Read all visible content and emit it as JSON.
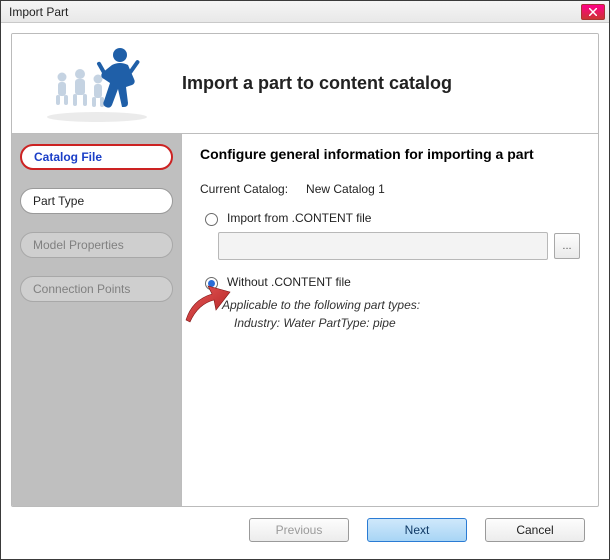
{
  "window": {
    "title": "Import Part"
  },
  "header": {
    "title": "Import a part to content catalog"
  },
  "sidebar": {
    "steps": [
      {
        "label": "Catalog File"
      },
      {
        "label": "Part Type"
      },
      {
        "label": "Model Properties"
      },
      {
        "label": "Connection Points"
      }
    ]
  },
  "main": {
    "section_title": "Configure general information for importing a part",
    "current_catalog_label": "Current Catalog:",
    "current_catalog_value": "New Catalog 1",
    "option_import_label": "Import from .CONTENT file",
    "path_value": "",
    "browse_label": "...",
    "option_without_label": "Without .CONTENT file",
    "hint_line1": "Applicable to the following part types:",
    "hint_line2": "Industry: Water   PartType: pipe"
  },
  "footer": {
    "previous": "Previous",
    "next": "Next",
    "cancel": "Cancel"
  }
}
